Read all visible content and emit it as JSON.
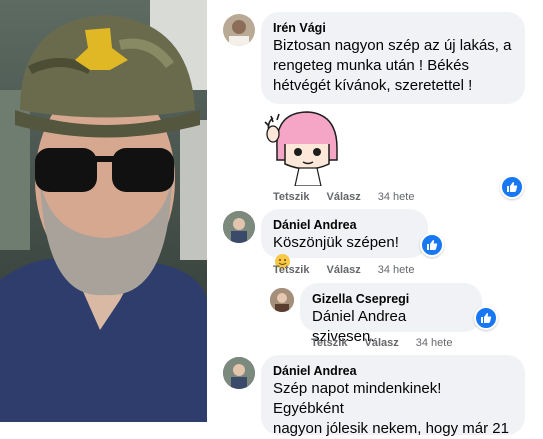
{
  "comments": [
    {
      "author": "Irén Vági",
      "text_lines": [
        "Biztosan nagyon szép az új lakás, a",
        "rengeteg munka után ! Békés",
        "hétvégét kívánok, szeretettel !"
      ],
      "sticker": "waving-girl-sticker",
      "actions": {
        "like": "Tetszik",
        "reply": "Válasz",
        "time": "34 hete"
      }
    },
    {
      "author": "Dániel Andrea",
      "text": "Köszönjük szépen!",
      "emoji": "smiling-face-icon",
      "actions": {
        "like": "Tetszik",
        "reply": "Válasz",
        "time": "34 hete"
      }
    },
    {
      "author": "Gizella Csepregi",
      "mention": "Dániel Andrea",
      "text": "szivesen.",
      "actions": {
        "like": "Tetszik",
        "reply": "Válasz",
        "time": "34 hete"
      }
    },
    {
      "author": "Dániel Andrea",
      "text_lines": [
        "Szép napot mindenkinek! Egyébként",
        "nagyon jólesik nekem, hogy már 21"
      ]
    }
  ],
  "colors": {
    "bubble": "#f0f2f5",
    "like_blue": "#1877f2",
    "meta_gray": "#65676b"
  }
}
